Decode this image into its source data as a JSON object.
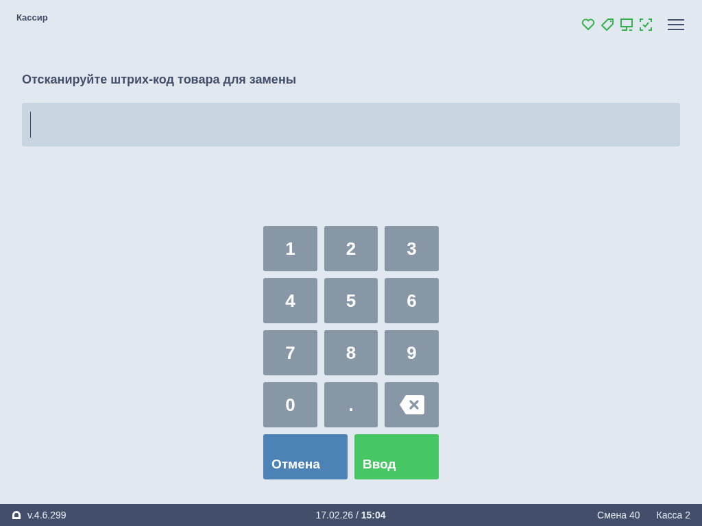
{
  "header": {
    "title": "Кассир"
  },
  "prompt": "Отсканируйте штрих-код товара для замены",
  "barcode_field": {
    "focused": true
  },
  "keypad": {
    "keys": [
      {
        "kind": "digit",
        "label": "1"
      },
      {
        "kind": "digit",
        "label": "2"
      },
      {
        "kind": "digit",
        "label": "3"
      },
      {
        "kind": "digit",
        "label": "4"
      },
      {
        "kind": "digit",
        "label": "5"
      },
      {
        "kind": "digit",
        "label": "6"
      },
      {
        "kind": "digit",
        "label": "7"
      },
      {
        "kind": "digit",
        "label": "8"
      },
      {
        "kind": "digit",
        "label": "9"
      },
      {
        "kind": "digit",
        "label": "0"
      },
      {
        "kind": "digit",
        "label": "."
      },
      {
        "kind": "backspace"
      }
    ],
    "actions": [
      {
        "kind": "cancel",
        "label": "Отмена"
      },
      {
        "kind": "enter",
        "label": "Ввод"
      }
    ]
  },
  "status_bar": {
    "version": "v.4.6.299",
    "datetime": "17.02.26 / **15:04**",
    "shift": "Смена 40",
    "register": "Касса 2"
  }
}
